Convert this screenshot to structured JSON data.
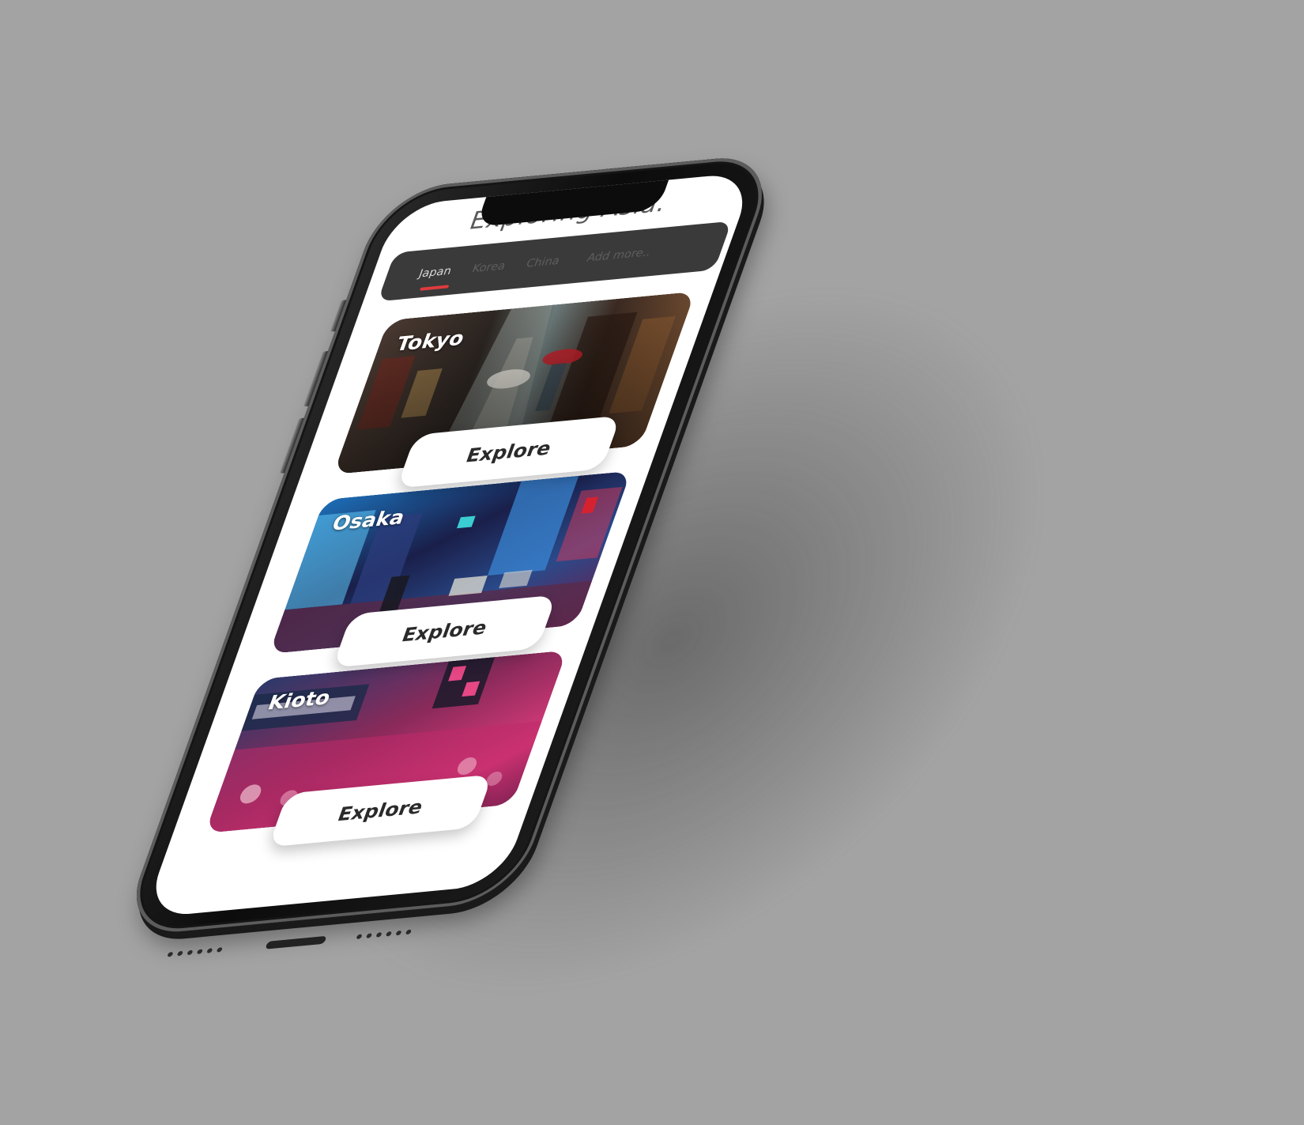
{
  "app": {
    "title": "Exploring Asia."
  },
  "tabs": [
    {
      "label": "Japan",
      "active": true
    },
    {
      "label": "Korea",
      "active": false
    },
    {
      "label": "China",
      "active": false
    },
    {
      "label": "Add more..",
      "active": false
    }
  ],
  "cards": [
    {
      "city": "Tokyo",
      "button_label": "Explore",
      "image": "tokyo-street-photo"
    },
    {
      "city": "Osaka",
      "button_label": "Explore",
      "image": "osaka-night-photo"
    },
    {
      "city": "Kioto",
      "button_label": "Explore",
      "image": "kioto-neon-photo"
    }
  ],
  "colors": {
    "background": "#a3a3a3",
    "screen": "#ffffff",
    "tab_bar": "#3a3a3a",
    "tab_indicator": "#e03a3e",
    "button_text": "#2a2a2a"
  }
}
